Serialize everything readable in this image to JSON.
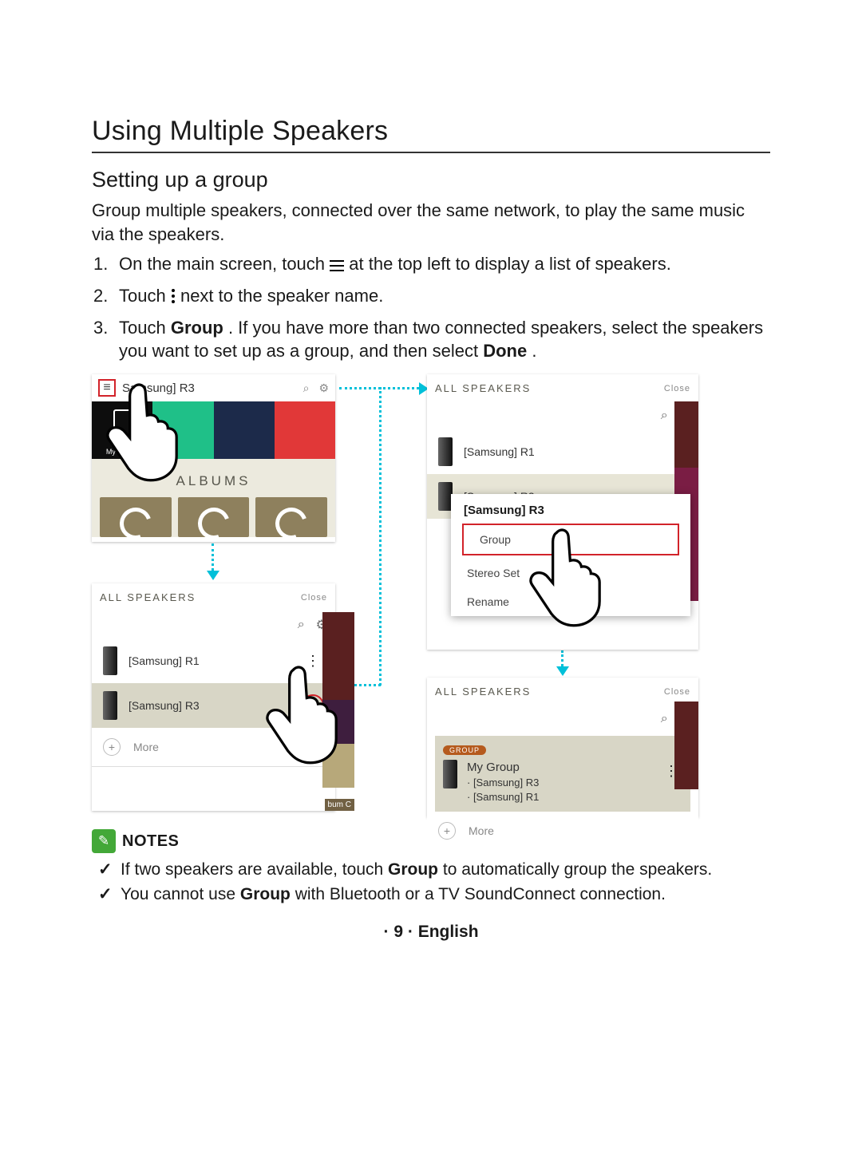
{
  "title": "Using Multiple Speakers",
  "subtitle": "Setting up a group",
  "intro": "Group multiple speakers, connected over the same network, to play the same music via the speakers.",
  "steps": {
    "s1_pre": "On the main screen, touch ",
    "s1_post": " at the top left to display a list of speakers.",
    "s2_pre": "Touch ",
    "s2_post": " next to the speaker name.",
    "s3_pre": "Touch ",
    "s3_bold1": "Group",
    "s3_mid": ". If you have more than two connected speakers, select the speakers you want to set up as a group, and then select ",
    "s3_bold2": "Done",
    "s3_post": "."
  },
  "shot1": {
    "title": "Samsung] R3",
    "myphone": "My Phone",
    "albums": "ALBUMS"
  },
  "shot2": {
    "header": "ALL SPEAKERS",
    "close": "Close",
    "spk1": "[Samsung] R1",
    "spk2": "[Samsung] R3",
    "more": "More",
    "bumc": "bum C"
  },
  "shot3": {
    "header": "ALL SPEAKERS",
    "close": "Close",
    "spk1": "[Samsung] R1",
    "spk2": "[Samsung] R3",
    "popup_title": "[Samsung] R3",
    "menu_group": "Group",
    "menu_stereo": "Stereo Set",
    "menu_rename": "Rename"
  },
  "shot4": {
    "header": "ALL SPEAKERS",
    "close": "Close",
    "badge": "GROUP",
    "group_name": "My Group",
    "member1": "· [Samsung] R3",
    "member2": "· [Samsung] R1",
    "more": "More"
  },
  "notes": {
    "label": "NOTES",
    "n1_pre": "If two speakers are available, touch ",
    "n1_bold": "Group",
    "n1_post": " to automatically group the speakers.",
    "n2_pre": "You cannot use ",
    "n2_bold": "Group",
    "n2_post": " with Bluetooth or a TV SoundConnect connection."
  },
  "footer": {
    "page": "9",
    "lang": "English"
  }
}
